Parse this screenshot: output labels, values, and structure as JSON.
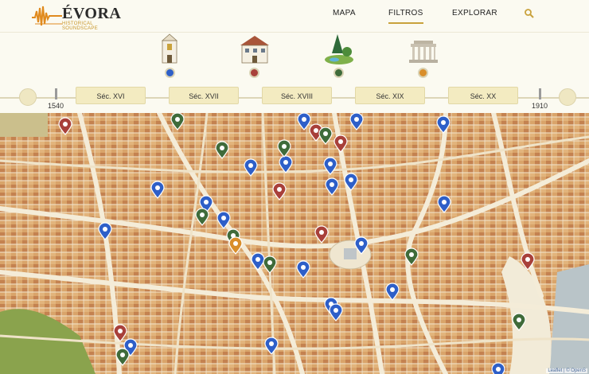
{
  "header": {
    "logo_title": "ÉVORA",
    "logo_subtitle": "HISTORICAL SOUNDSCAPE",
    "nav": [
      {
        "label": "MAPA",
        "active": false
      },
      {
        "label": "FILTROS",
        "active": true
      },
      {
        "label": "EXPLORAR",
        "active": false
      }
    ],
    "search_icon": "search-icon",
    "accent": "#c9a23c"
  },
  "categories": [
    {
      "icon": "tower-icon",
      "color": "#2e5fc8"
    },
    {
      "icon": "house-icon",
      "color": "#a8403a"
    },
    {
      "icon": "garden-icon",
      "color": "#3f6b3a"
    },
    {
      "icon": "temple-icon",
      "color": "#d98e2a"
    }
  ],
  "timeline": {
    "start_year": "1540",
    "end_year": "1910",
    "centuries": [
      "Séc. XVI",
      "Séc. XVII",
      "Séc. XVIII",
      "Séc. XIX",
      "Séc. XX"
    ]
  },
  "map": {
    "attribution": "Leaflet | © OpenS"
  }
}
